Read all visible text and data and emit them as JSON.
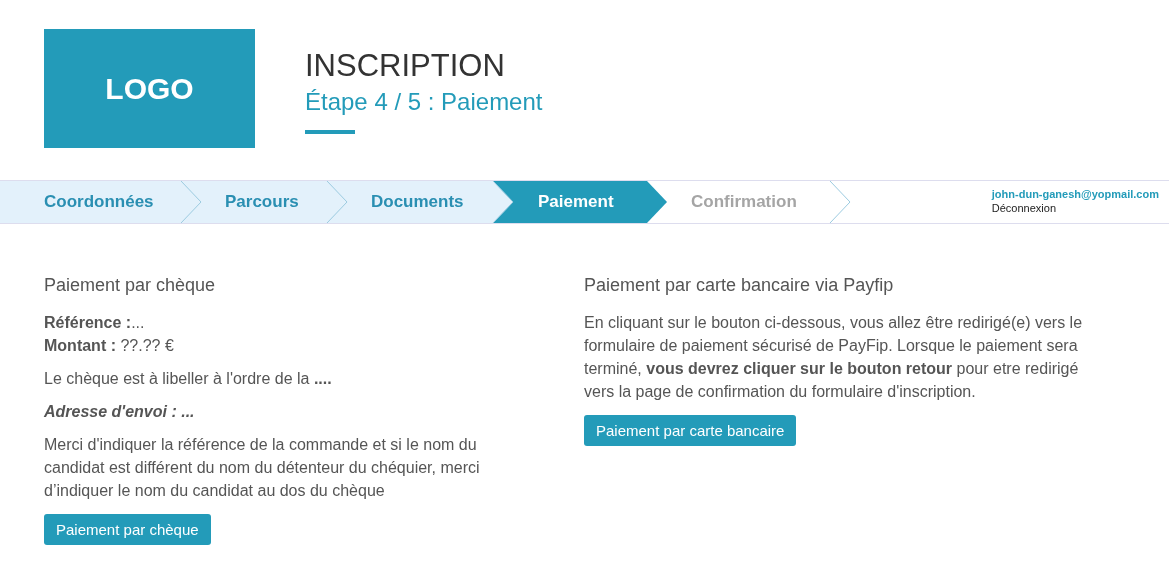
{
  "header": {
    "logo": "LOGO",
    "title": "INSCRIPTION",
    "subtitle": "Étape 4 / 5 : Paiement"
  },
  "steps": [
    {
      "label": "Coordonnées",
      "completed": true,
      "selected": false
    },
    {
      "label": "Parcours",
      "completed": true,
      "selected": false
    },
    {
      "label": "Documents",
      "completed": true,
      "selected": false
    },
    {
      "label": "Paiement",
      "completed": false,
      "selected": true
    },
    {
      "label": "Confirmation",
      "completed": false,
      "selected": false
    }
  ],
  "user": {
    "email": "john-dun-ganesh@yopmail.com",
    "logout": "Déconnexion"
  },
  "cheque": {
    "heading": "Paiement par chèque",
    "reference": "**Référence :**...",
    "amount": "**Montant :** ??.?? €",
    "order": "Le chèque est à libeller à l'ordre de la **....**",
    "address": "Adresse d'envoi : ...",
    "note": "Merci d'indiquer la référence de la commande et si le nom du candidat est différent du nom du détenteur du chéquier, merci d’indiquer le nom du candidat au dos du chèque",
    "button": "Paiement par chèque"
  },
  "card": {
    "heading": "Paiement par carte bancaire via Payfip",
    "text": "En cliquant sur le bouton ci-dessous, vous allez être redirigé(e) vers le formulaire de paiement sécurisé de PayFip. Lorsque le paiement sera terminé, **vous devrez cliquer sur le bouton retour** pour etre redirigé vers la page de confirmation du formulaire d'inscription.",
    "button": "Paiement par carte bancaire"
  }
}
